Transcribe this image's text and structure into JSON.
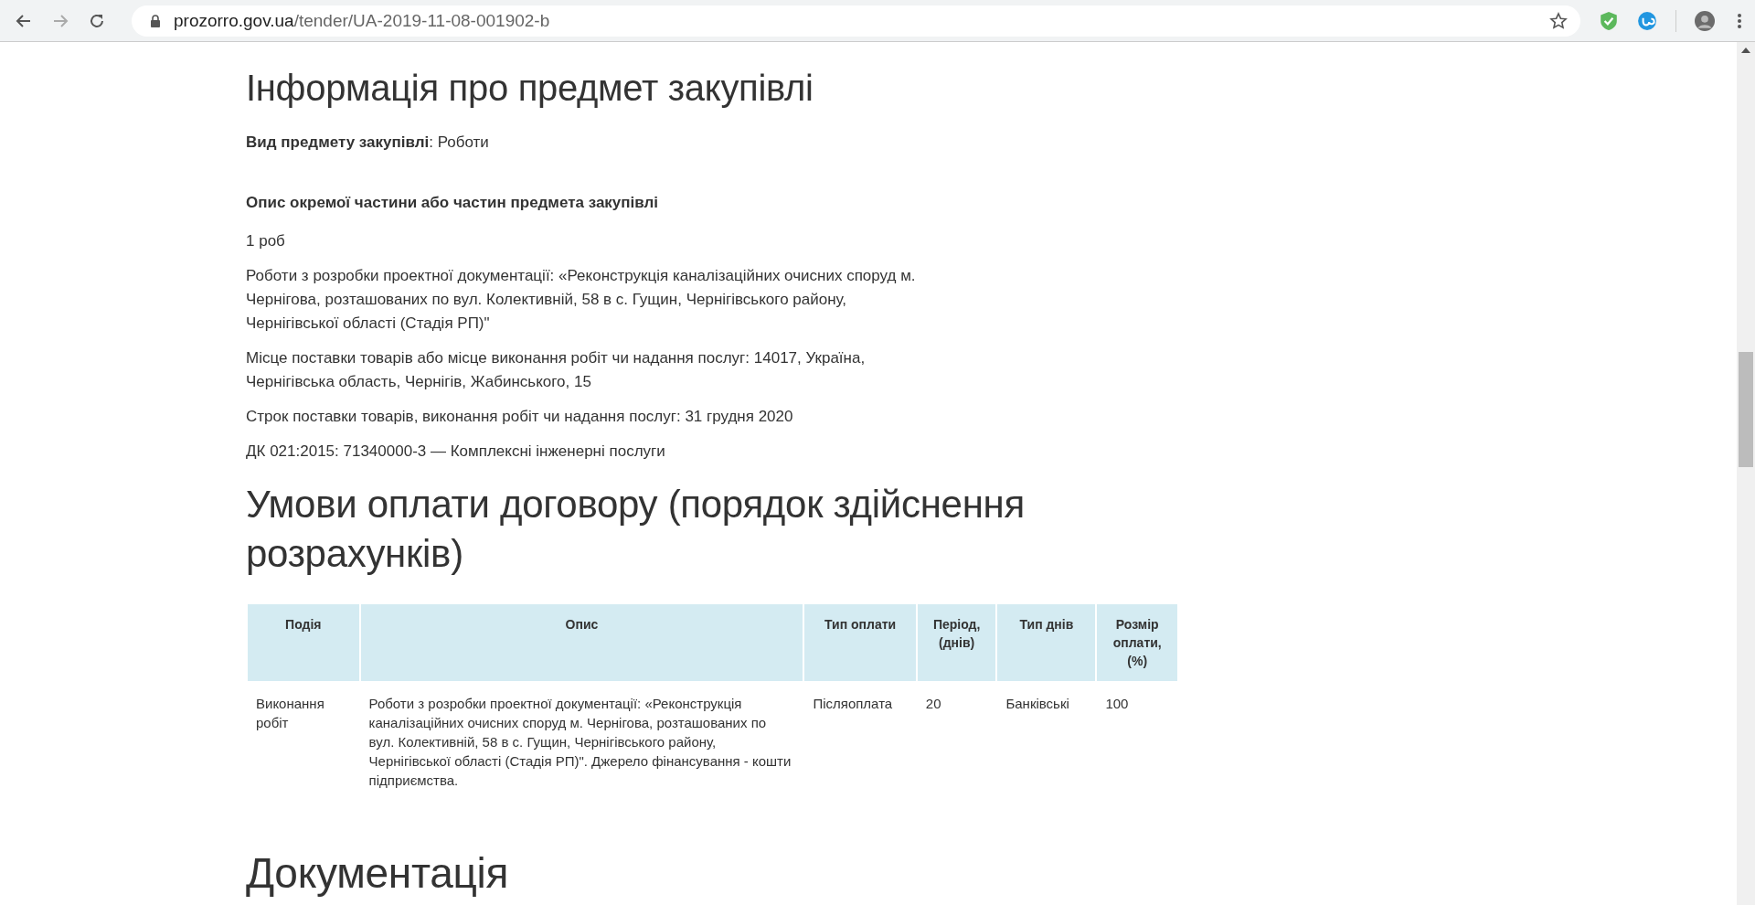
{
  "browser": {
    "url_domain": "prozorro.gov.ua",
    "url_path": "/tender/UA-2019-11-08-001902-b"
  },
  "procurement": {
    "heading": "Інформація про предмет закупівлі",
    "kind_line": "**Вид предмету закупівлі**: Роботи",
    "lot_title": "Опис окремої частини або частин предмета закупівлі",
    "paragraphs": [
      "1 роб",
      "Роботи з розробки проектної документації: «Реконструкція каналізаційних очисних споруд м. Чернігова, розташованих по вул. Колективній, 58 в с. Гущин, Чернігівського району, Чернігівської області (Стадія РП)\"",
      "Місце поставки товарів або місце виконання робіт чи надання послуг: 14017, Україна, Чернігівська область, Чернігів, Жабинського, 15",
      "Строк поставки товарів, виконання робіт чи надання послуг: 31 грудня 2020",
      "ДК 021:2015: 71340000-3 — Комплексні інженерні послуги"
    ]
  },
  "payment": {
    "heading": "Умови оплати договору (порядок здійснення розрахунків)",
    "table": {
      "columns": [
        "Подія",
        "Опис",
        "Тип оплати",
        "Період, (днів)",
        "Тип днів",
        "Розмір оплати, (%)"
      ],
      "rows": [
        [
          "Виконання робіт",
          "Роботи з розробки проектної документації: «Реконструкція каналізаційних очисних споруд м. Чернігова, розташованих по вул. Колективній, 58 в с. Гущин, Чернігівського району, Чернігівської області (Стадія РП)\". Джерело фінансування - кошти підприємства.",
          "Післяоплата",
          "20",
          "Банківські",
          "100"
        ]
      ]
    }
  },
  "documentation": {
    "heading": "Документація"
  }
}
